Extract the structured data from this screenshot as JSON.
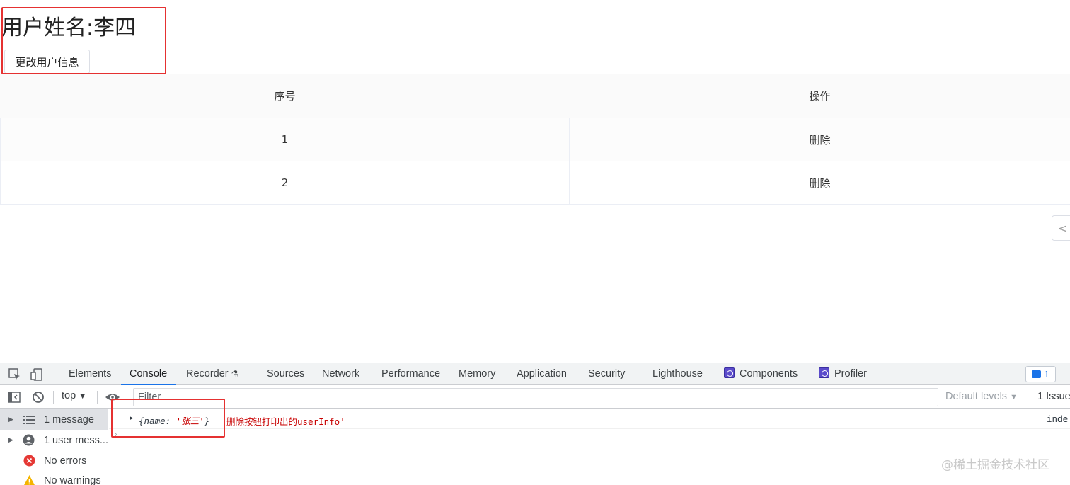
{
  "page": {
    "user_title": "用户姓名:李四",
    "change_button": "更改用户信息"
  },
  "table": {
    "headers": [
      "序号",
      "操作"
    ],
    "rows": [
      {
        "index": "1",
        "action": "删除"
      },
      {
        "index": "2",
        "action": "删除"
      }
    ]
  },
  "side_handle": "<",
  "devtools": {
    "tabs": [
      "Elements",
      "Console",
      "Recorder",
      "Sources",
      "Network",
      "Performance",
      "Memory",
      "Application",
      "Security",
      "Lighthouse",
      "Components",
      "Profiler"
    ],
    "active_tab": "Console",
    "issues_badge": "1",
    "context": "top",
    "filter_placeholder": "Filter",
    "levels": "Default levels",
    "issues_count": "1 Issue:",
    "sidebar": [
      {
        "label": "1 message",
        "icon": "list-icon"
      },
      {
        "label": "1 user mess...",
        "icon": "user-icon"
      },
      {
        "label": "No errors",
        "icon": "error-icon"
      },
      {
        "label": "No warnings",
        "icon": "warning-icon"
      }
    ],
    "log": {
      "obj_prefix": "{name: ",
      "obj_value": "'张三'",
      "obj_suffix": "}",
      "message": "删除按钮打印出的userInfo'",
      "source": "inde"
    }
  },
  "watermark": "@稀土掘金技术社区",
  "colors": {
    "highlight_box": "#e53131",
    "active_tab_underline": "#1a73e8",
    "console_string": "#c80000"
  }
}
